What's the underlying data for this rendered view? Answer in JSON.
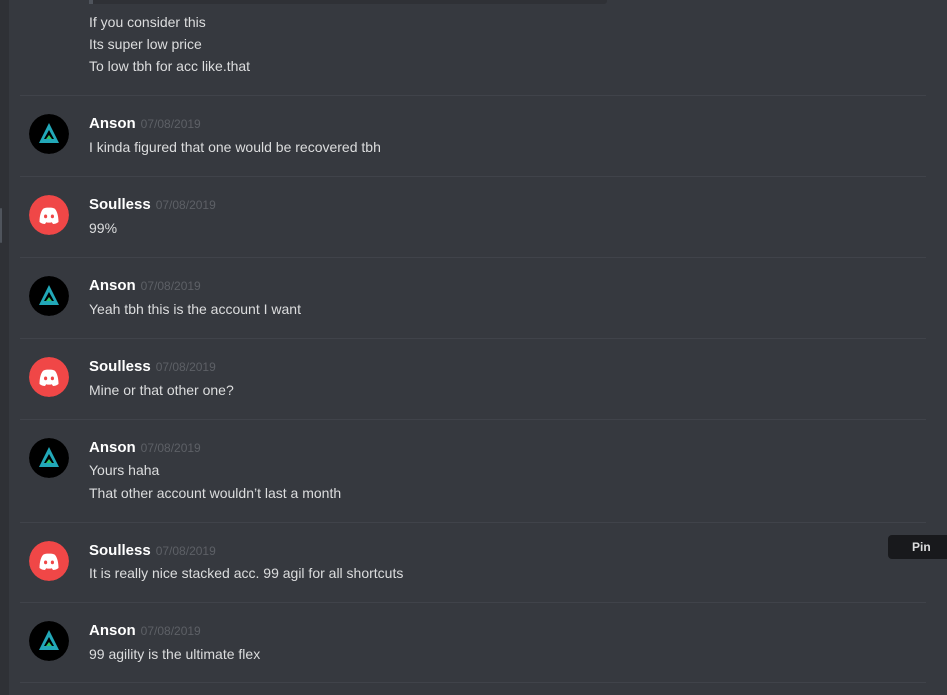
{
  "top_lines": [
    "If you consider this",
    "Its super low price",
    "To low tbh for acc like.that"
  ],
  "messages": [
    {
      "author": "Anson",
      "date": "07/08/2019",
      "avatar": "anson-logo-icon",
      "lines": [
        "I kinda figured that one would be recovered tbh"
      ]
    },
    {
      "author": "Soulless",
      "date": "07/08/2019",
      "avatar": "discord-logo-icon",
      "lines": [
        "99%"
      ]
    },
    {
      "author": "Anson",
      "date": "07/08/2019",
      "avatar": "anson-logo-icon",
      "lines": [
        "Yeah tbh this is the account I want"
      ]
    },
    {
      "author": "Soulless",
      "date": "07/08/2019",
      "avatar": "discord-logo-icon",
      "lines": [
        "Mine or that other one?"
      ]
    },
    {
      "author": "Anson",
      "date": "07/08/2019",
      "avatar": "anson-logo-icon",
      "lines": [
        "Yours haha",
        "That other account wouldn’t last a month"
      ]
    },
    {
      "author": "Soulless",
      "date": "07/08/2019",
      "avatar": "discord-logo-icon",
      "lines": [
        "It is really nice stacked acc. 99 agil for all shortcuts"
      ]
    },
    {
      "author": "Anson",
      "date": "07/08/2019",
      "avatar": "anson-logo-icon",
      "lines": [
        "99 agility is the ultimate flex"
      ]
    }
  ],
  "tooltip": {
    "label": "Pin"
  },
  "colors": {
    "background": "#36393f",
    "username": "#ffffff",
    "message_text": "#dcddde",
    "timestamp": "#5d6066",
    "discord_avatar_red": "#f04747",
    "anson_avatar_teal": "#22a8b8"
  }
}
